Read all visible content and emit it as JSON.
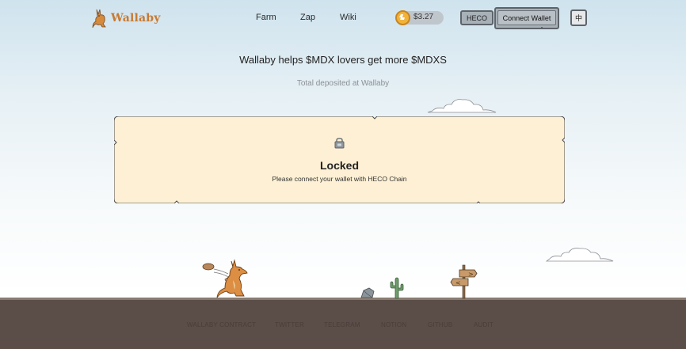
{
  "brand": {
    "name": "Wallaby"
  },
  "nav": [
    {
      "label": "Farm"
    },
    {
      "label": "Zap"
    },
    {
      "label": "Wiki"
    }
  ],
  "price": {
    "value": "$3.27",
    "coin_icon": "mdx-coin-icon"
  },
  "chain": {
    "label": "HECO"
  },
  "wallet": {
    "connect_label": "Connect Wallet"
  },
  "language": {
    "label": "中"
  },
  "hero": {
    "headline": "Wallaby helps $MDX lovers get more $MDXS",
    "subheadline": "Total deposited at Wallaby"
  },
  "card": {
    "icon": "lock-icon",
    "title": "Locked",
    "message": "Please connect your wallet with HECO Chain"
  },
  "signpost": {
    "right_arrow": ">",
    "left_arrow": "<"
  },
  "footer": [
    {
      "label": "WALLABY CONTRACT"
    },
    {
      "label": "TWITTER"
    },
    {
      "label": "TELEGRAM"
    },
    {
      "label": "NOTION"
    },
    {
      "label": "GITHUB"
    },
    {
      "label": "AUDIT"
    }
  ],
  "colors": {
    "sky_top": "#cfe3ee",
    "card_fill": "#fdf0d4",
    "ground": "#5b4d48",
    "brand_orange": "#c87a32"
  }
}
